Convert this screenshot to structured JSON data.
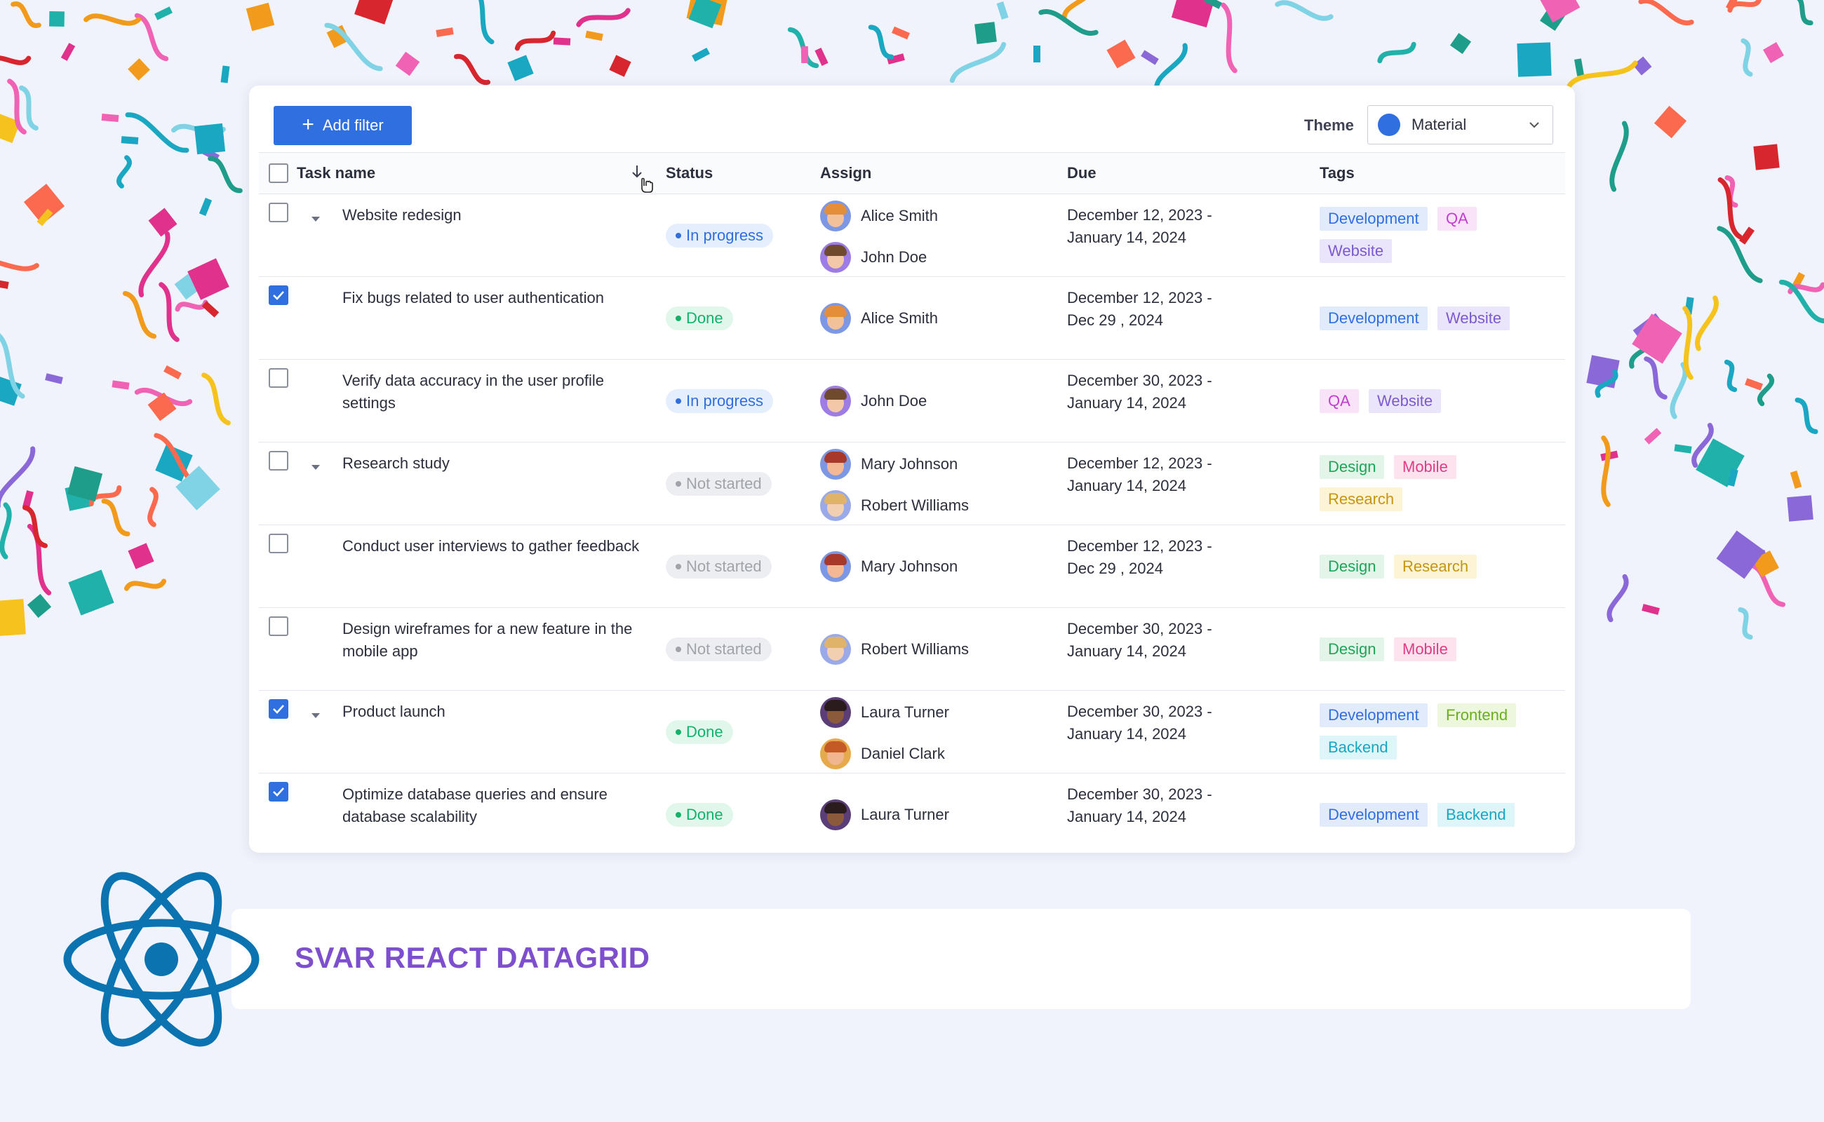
{
  "toolbar": {
    "add_filter_label": "Add filter",
    "theme_label": "Theme",
    "theme_value": "Material"
  },
  "columns": {
    "task_name": "Task name",
    "status": "Status",
    "assign": "Assign",
    "due": "Due",
    "tags": "Tags"
  },
  "colors": {
    "accent": "#2f6fdf",
    "status_in_progress": "#2f6fdf",
    "status_done": "#13b26b",
    "status_not_started": "#9aa0a6",
    "banner_title": "#7e4fcc",
    "react": "#0a73b0"
  },
  "rows": [
    {
      "checked": false,
      "expandable": true,
      "task": "Website redesign",
      "status": "In progress",
      "assignees": [
        "Alice Smith",
        "John Doe"
      ],
      "due": [
        "December 12, 2023 -",
        "January 14, 2024"
      ],
      "tags": [
        "Development",
        "QA",
        "Website"
      ]
    },
    {
      "checked": true,
      "expandable": false,
      "task": "Fix bugs related to user authentication",
      "status": "Done",
      "assignees": [
        "Alice Smith"
      ],
      "due": [
        "December 12, 2023 -",
        "Dec 29 , 2024"
      ],
      "tags": [
        "Development",
        "Website"
      ]
    },
    {
      "checked": false,
      "expandable": false,
      "task": "Verify data accuracy in the user profile settings",
      "status": "In progress",
      "assignees": [
        "John Doe"
      ],
      "due": [
        "December 30, 2023 -",
        "January 14, 2024"
      ],
      "tags": [
        "QA",
        "Website"
      ]
    },
    {
      "checked": false,
      "expandable": true,
      "task": "Research study",
      "status": "Not started",
      "assignees": [
        "Mary Johnson",
        "Robert Williams"
      ],
      "due": [
        "December 12, 2023 -",
        "January 14, 2024"
      ],
      "tags": [
        "Design",
        "Mobile",
        "Research"
      ]
    },
    {
      "checked": false,
      "expandable": false,
      "task": "Conduct user interviews to gather feedback",
      "status": "Not started",
      "assignees": [
        "Mary Johnson"
      ],
      "due": [
        "December 12, 2023 -",
        "Dec 29 , 2024"
      ],
      "tags": [
        "Design",
        "Research"
      ]
    },
    {
      "checked": false,
      "expandable": false,
      "task": "Design wireframes for a new feature in the mobile app",
      "status": "Not started",
      "assignees": [
        "Robert Williams"
      ],
      "due": [
        "December 30, 2023 -",
        "January 14, 2024"
      ],
      "tags": [
        "Design",
        "Mobile"
      ]
    },
    {
      "checked": true,
      "expandable": true,
      "task": "Product launch",
      "status": "Done",
      "assignees": [
        "Laura Turner",
        "Daniel Clark"
      ],
      "due": [
        "December 30, 2023 -",
        "January 14, 2024"
      ],
      "tags": [
        "Development",
        "Frontend",
        "Backend"
      ]
    },
    {
      "checked": true,
      "expandable": false,
      "task": "Optimize database queries and ensure database scalability",
      "status": "Done",
      "assignees": [
        "Laura Turner"
      ],
      "due": [
        "December 30, 2023 -",
        "January 14, 2024"
      ],
      "tags": [
        "Development",
        "Backend"
      ]
    }
  ],
  "banner": {
    "title": "SVAR REACT DATAGRID"
  }
}
